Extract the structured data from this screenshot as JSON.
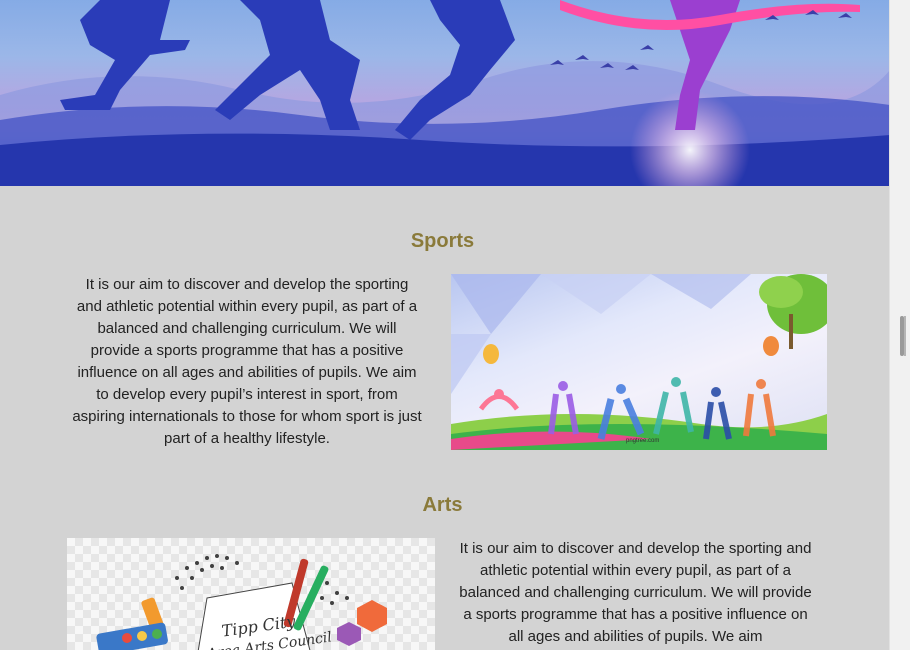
{
  "sports": {
    "title": "Sports",
    "text": "It is our aim to discover and develop the sporting and athletic potential within every pupil, as part of a balanced and challenging curriculum. We will provide a sports programme that has a positive influence on all ages and abilities of pupils. We aim to develop every pupil’s interest in sport, from aspiring internationals to those for whom sport is just part of a healthy lifestyle.",
    "image_watermark": "pngtree.com"
  },
  "arts": {
    "title": "Arts",
    "text": "It is our aim to discover and develop the sporting and athletic potential within every pupil, as part of a balanced and challenging curriculum. We will provide a sports programme that has a positive influence on all ages and abilities of pupils. We aim",
    "image_text_line1": "Tipp City",
    "image_text_line2": "Area Arts Council"
  }
}
